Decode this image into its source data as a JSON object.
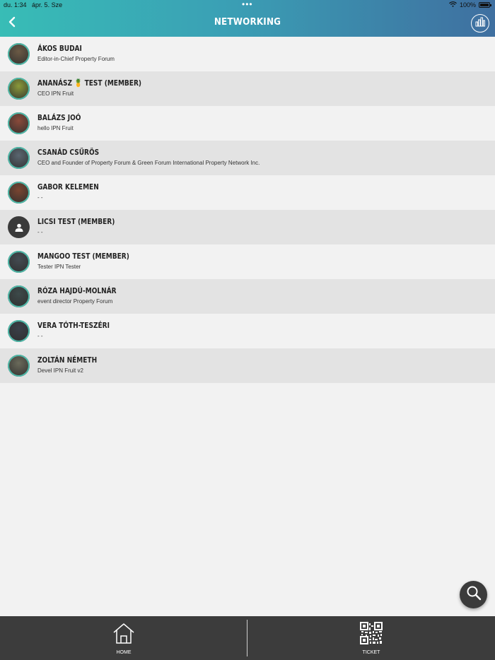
{
  "status_bar": {
    "time": "du. 1:34",
    "date": "ápr. 5. Sze",
    "dots": "•••",
    "battery": "100%"
  },
  "header": {
    "title": "NETWORKING",
    "back_icon": "chevron-left-icon",
    "stats_icon": "bar-chart-icon"
  },
  "people": [
    {
      "name": "ÁKOS BUDAI",
      "subtitle": "Editor-in-Chief Property Forum",
      "avatar": "photo",
      "avatar_color": "#6b5a45"
    },
    {
      "name": "ANANÁSZ 🍍 TEST (MEMBER)",
      "subtitle": "CEO IPN Fruit",
      "avatar": "photo",
      "avatar_color": "#8a9a3a"
    },
    {
      "name": "BALÁZS JOÓ",
      "subtitle": "hello IPN Fruit",
      "avatar": "photo",
      "avatar_color": "#8a4a3a"
    },
    {
      "name": "CSANÁD CSŰRÖS",
      "subtitle": "CEO and Founder of Property Forum & Green Forum International Property Network Inc.",
      "avatar": "photo",
      "avatar_color": "#5a6670"
    },
    {
      "name": "GABOR KELEMEN",
      "subtitle": "- -",
      "avatar": "photo",
      "avatar_color": "#7a4530"
    },
    {
      "name": "LICSI TEST (MEMBER)",
      "subtitle": "- -",
      "avatar": "default",
      "avatar_color": "#3a3a3a"
    },
    {
      "name": "MANGOO TEST (MEMBER)",
      "subtitle": "Tester IPN Tester",
      "avatar": "photo",
      "avatar_color": "#444b52"
    },
    {
      "name": "RÓZA HAJDÚ-MOLNÁR",
      "subtitle": "event director Property Forum",
      "avatar": "photo",
      "avatar_color": "#3d4a4a"
    },
    {
      "name": "VERA TÓTH-TESZÉRI",
      "subtitle": "- -",
      "avatar": "photo",
      "avatar_color": "#3a3f48"
    },
    {
      "name": "ZOLTÁN NÉMETH",
      "subtitle": "Devel IPN Fruit v2",
      "avatar": "photo",
      "avatar_color": "#6a6a5a"
    }
  ],
  "fab": {
    "icon": "search-icon"
  },
  "tabbar": {
    "home_label": "HOME",
    "ticket_label": "TICKET",
    "home_icon": "house-icon",
    "ticket_icon": "qr-code-icon"
  },
  "colors": {
    "header_start": "#38bdb6",
    "header_end": "#3f6fa0",
    "tabbar": "#3c3c3c",
    "row_alt": "#e3e3e3",
    "background": "#f2f2f2"
  }
}
